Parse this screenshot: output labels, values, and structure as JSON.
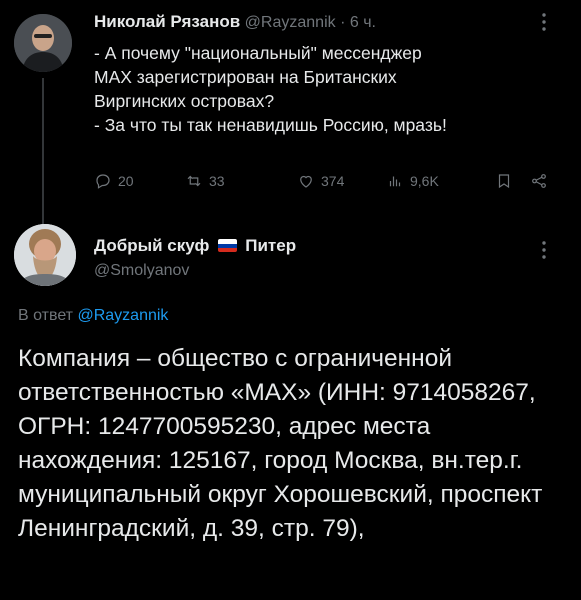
{
  "tweet1": {
    "author_name": "Николай Рязанов",
    "handle": "@Rayzannik",
    "time": "· 6 ч.",
    "text": "- А почему \"национальный\" мессенджер\nMAX зарегистрирован на Британских\nВиргинских островах?\n- За что ты так ненавидишь Россию, мразь!",
    "actions": {
      "replies": "20",
      "retweets": "33",
      "likes": "374",
      "views": "9,6K"
    }
  },
  "tweet2": {
    "author_name": "Добрый скуф",
    "author_name_suffix": "Питер",
    "handle": "@Smolyanov",
    "reply_prefix": "В ответ",
    "reply_to": "@Rayzannik",
    "text": "Компания – общество с ограниченной ответственностью «МАХ» (ИНН: 9714058267, ОГРН: 1247700595230, адрес места нахождения: 125167, город Москва, вн.тер.г. муниципальный округ Хорошевский, проспект Ленинградский, д. 39, стр. 79),"
  },
  "colors": {
    "background": "#000000",
    "text": "#e7e9ea",
    "muted": "#71767b",
    "accent": "#1d9bf0"
  }
}
